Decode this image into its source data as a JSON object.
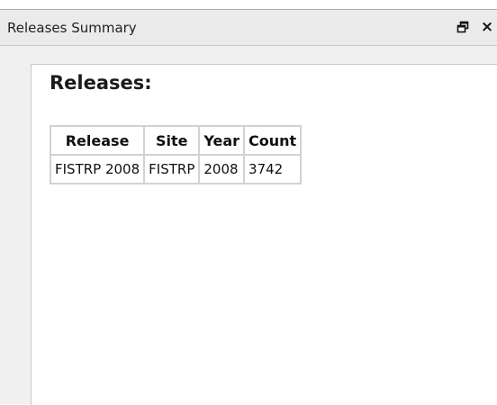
{
  "panel": {
    "title": "Releases Summary",
    "restore_icon": "restore-window-icon",
    "close_label": "×"
  },
  "content": {
    "heading": "Releases:",
    "table": {
      "columns": [
        "Release",
        "Site",
        "Year",
        "Count"
      ],
      "rows": [
        [
          "FISTRP 2008",
          "FISTRP",
          "2008",
          "3742"
        ]
      ]
    }
  }
}
